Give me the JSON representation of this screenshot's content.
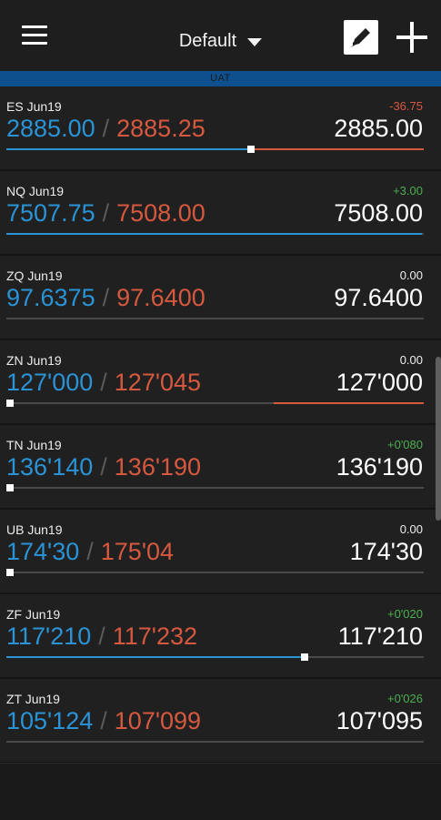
{
  "header": {
    "menu_icon": "hamburger-menu-icon",
    "title": "Default",
    "dropdown_icon": "chevron-down-icon",
    "edit_icon": "edit-pencil-icon",
    "add_icon": "plus-icon"
  },
  "environment_banner": "UAT",
  "colors": {
    "bid": "#2a93d6",
    "ask": "#d6583f",
    "positive": "#4caf50",
    "negative": "#d6583f",
    "neutral": "#eeeeee",
    "banner": "#0e4f8e"
  },
  "quotes": [
    {
      "symbol": "ES Jun19",
      "change": "-36.75",
      "change_status": "negative",
      "bid": "2885.00",
      "sep": "/",
      "ask": "2885.25",
      "last": "2885.00",
      "bar": {
        "blue": 0.585,
        "red": 0.415,
        "handle": 0.585
      }
    },
    {
      "symbol": "NQ Jun19",
      "change": "+3.00",
      "change_status": "positive",
      "bid": "7507.75",
      "sep": "/",
      "ask": "7508.00",
      "last": "7508.00",
      "bar": {
        "blue": 0.995,
        "red": 0.0,
        "handle": null
      }
    },
    {
      "symbol": "ZQ Jun19",
      "change": "0.00",
      "change_status": "neutral",
      "bid": "97.6375",
      "sep": "/",
      "ask": "97.6400",
      "last": "97.6400",
      "bar": {
        "blue": 0.0,
        "red": 0.0,
        "handle": null
      }
    },
    {
      "symbol": "ZN Jun19",
      "change": "0.00",
      "change_status": "neutral",
      "bid": "127'000",
      "sep": "/",
      "ask": "127'045",
      "last": "127'000",
      "bar": {
        "blue": 0.0,
        "red": 0.36,
        "handle": 0.0
      }
    },
    {
      "symbol": "TN Jun19",
      "change": "+0'080",
      "change_status": "positive",
      "bid": "136'140",
      "sep": "/",
      "ask": "136'190",
      "last": "136'190",
      "bar": {
        "blue": 0.0,
        "red": 0.0,
        "handle": 0.0
      }
    },
    {
      "symbol": "UB Jun19",
      "change": "0.00",
      "change_status": "neutral",
      "bid": "174'30",
      "sep": "/",
      "ask": "175'04",
      "last": "174'30",
      "bar": {
        "blue": 0.0,
        "red": 0.0,
        "handle": 0.0
      }
    },
    {
      "symbol": "ZF Jun19",
      "change": "+0'020",
      "change_status": "positive",
      "bid": "117'210",
      "sep": "/",
      "ask": "117'232",
      "last": "117'210",
      "bar": {
        "blue": 0.715,
        "red": 0.0,
        "handle": 0.715
      }
    },
    {
      "symbol": "ZT Jun19",
      "change": "+0'026",
      "change_status": "positive",
      "bid": "105'124",
      "sep": "/",
      "ask": "107'099",
      "last": "107'095",
      "bar": {
        "blue": 0.0,
        "red": 0.0,
        "handle": null
      }
    }
  ]
}
